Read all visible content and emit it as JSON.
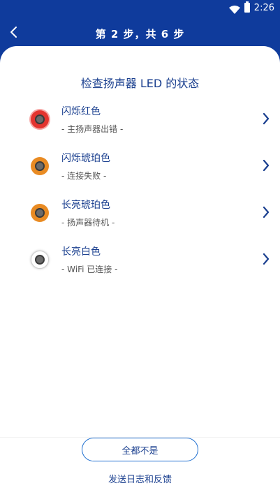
{
  "status_bar": {
    "time": "2:26"
  },
  "header": {
    "title": "第 2 步，共 6 步"
  },
  "main": {
    "title": "检查扬声器 LED 的状态",
    "items": [
      {
        "label": "闪烁红色",
        "description": "- 主扬声器出错 -",
        "color": "#e3342f"
      },
      {
        "label": "闪烁琥珀色",
        "description": "- 连接失败 -",
        "color": "#e98b23"
      },
      {
        "label": "长亮琥珀色",
        "description": "- 扬声器待机 -",
        "color": "#e98b23"
      },
      {
        "label": "长亮白色",
        "description": "- WiFi 已连接 -",
        "color": "#ffffff"
      }
    ]
  },
  "footer": {
    "none_button_label": "全都不是",
    "feedback_link": "发送日志和反馈"
  }
}
